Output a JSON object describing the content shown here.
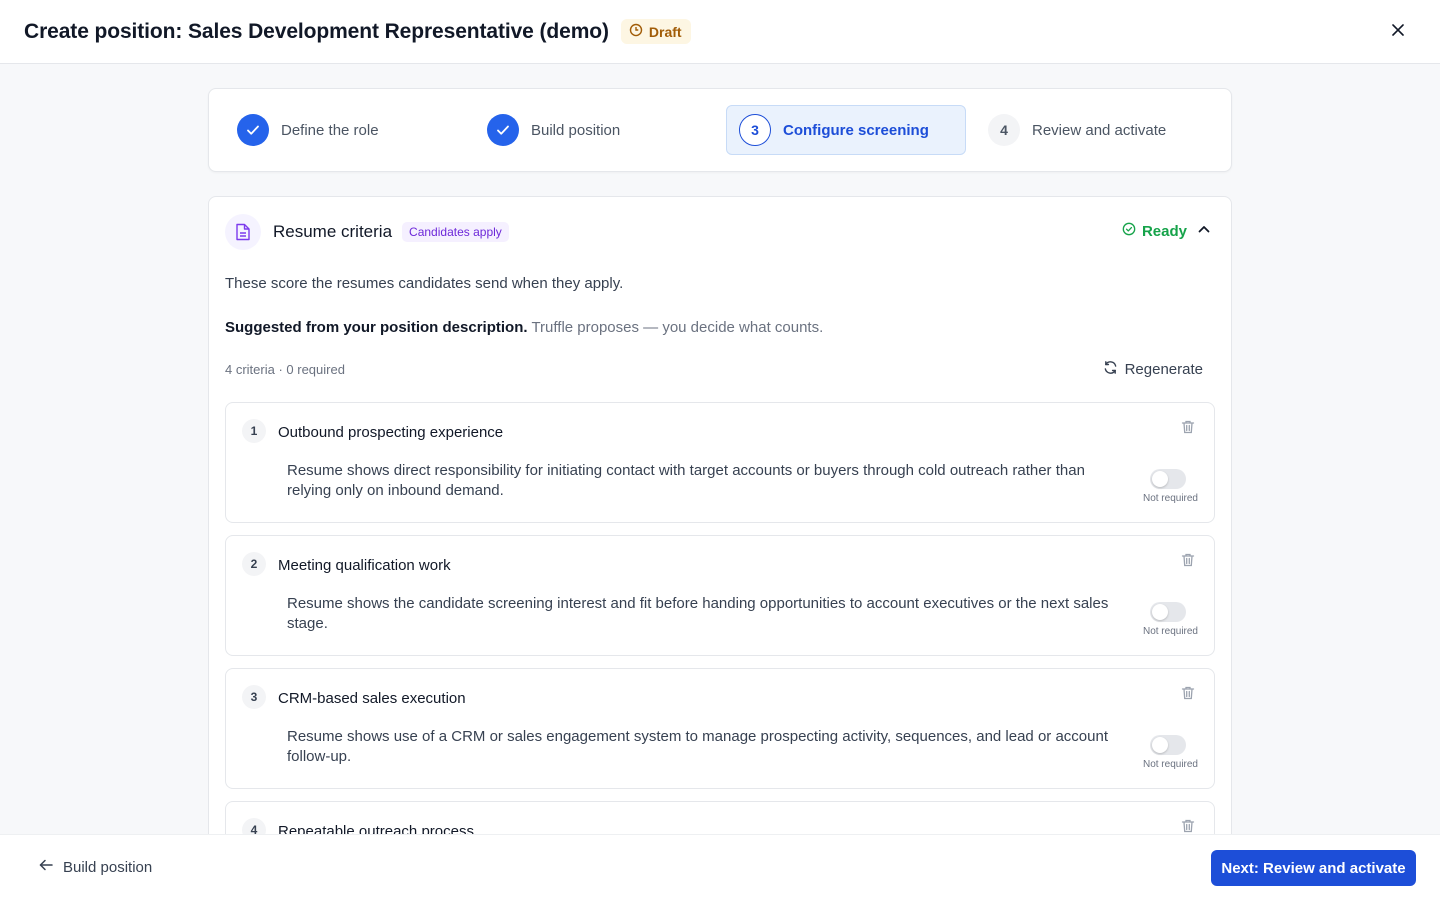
{
  "header": {
    "title": "Create position: Sales Development Representative (demo)",
    "status": "Draft",
    "status_color": "#a15c07"
  },
  "stepper": {
    "steps": [
      {
        "number": "1",
        "label": "Define the role",
        "state": "done"
      },
      {
        "number": "2",
        "label": "Build position",
        "state": "done"
      },
      {
        "number": "3",
        "label": "Configure screening",
        "state": "active"
      },
      {
        "number": "4",
        "label": "Review and activate",
        "state": "pending"
      }
    ]
  },
  "section": {
    "title": "Resume criteria",
    "badge": "Candidates apply",
    "status": "Ready",
    "description": "These score the resumes candidates send when they apply.",
    "suggested_bold": "Suggested from your position description.",
    "suggested_muted": "Truffle proposes — you decide what counts.",
    "meta": "4 criteria · 0 required",
    "regenerate": "Regenerate"
  },
  "criteria": [
    {
      "number": "1",
      "name": "Outbound prospecting experience",
      "description": "Resume shows direct responsibility for initiating contact with target accounts or buyers through cold outreach rather than relying only on inbound demand.",
      "required_label": "Not required",
      "required": false
    },
    {
      "number": "2",
      "name": "Meeting qualification work",
      "description": "Resume shows the candidate screening interest and fit before handing opportunities to account executives or the next sales stage.",
      "required_label": "Not required",
      "required": false
    },
    {
      "number": "3",
      "name": "CRM-based sales execution",
      "description": "Resume shows use of a CRM or sales engagement system to manage prospecting activity, sequences, and lead or account follow-up.",
      "required_label": "Not required",
      "required": false
    },
    {
      "number": "4",
      "name": "Repeatable outreach process",
      "description": "",
      "required_label": "",
      "required": false
    }
  ],
  "footer": {
    "back_label": "Build position",
    "next_label": "Next: Review and activate"
  },
  "colors": {
    "primary": "#1d4ed8",
    "success": "#16a34a",
    "purple": "#6d28d9"
  }
}
